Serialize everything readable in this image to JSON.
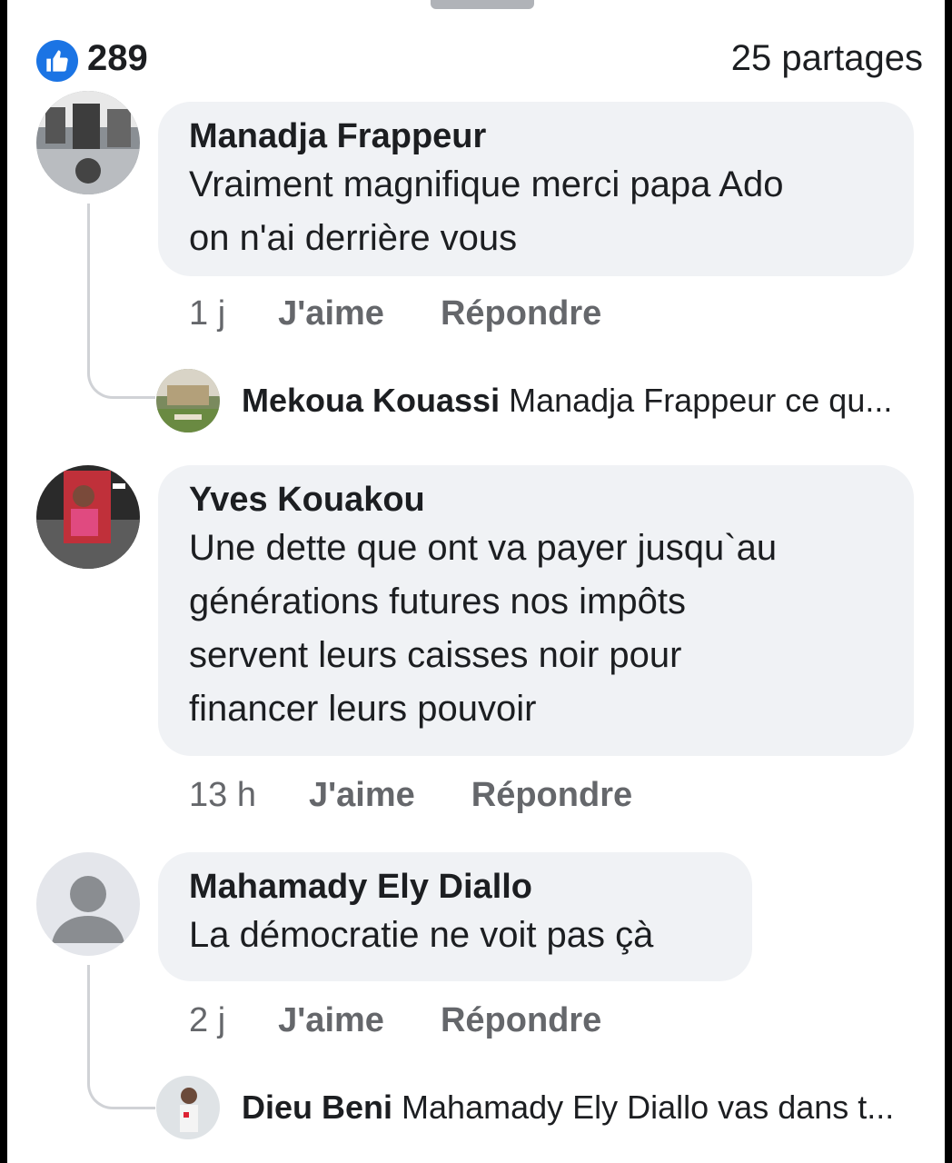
{
  "reactions": {
    "like_count": "289",
    "shares": "25 partages"
  },
  "comments": [
    {
      "author": "Manadja Frappeur",
      "lines": [
        "Vraiment magnifique merci papa Ado",
        "on n'ai derrière vous"
      ],
      "time": "1 j",
      "like_label": "J'aime",
      "reply_label": "Répondre",
      "reply_preview": {
        "author": "Mekoua Kouassi",
        "text": "Manadja Frappeur ce qu..."
      }
    },
    {
      "author": "Yves Kouakou",
      "lines": [
        "Une dette que ont va payer jusqu`au",
        "générations futures nos impôts",
        "servent leurs caisses noir pour",
        "financer leurs pouvoir"
      ],
      "time": "13 h",
      "like_label": "J'aime",
      "reply_label": "Répondre"
    },
    {
      "author": "Mahamady Ely Diallo",
      "lines": [
        "La démocratie ne voit pas çà"
      ],
      "time": "2 j",
      "like_label": "J'aime",
      "reply_label": "Répondre",
      "reply_preview": {
        "author": "Dieu Beni",
        "text": "Mahamady Ely Diallo vas dans t..."
      }
    }
  ],
  "icons": {
    "like": "thumbs-up-icon",
    "default_avatar": "default-user-avatar"
  },
  "colors": {
    "facebook_blue": "#1b74e4",
    "bubble": "#f0f2f5",
    "muted": "#65676b"
  }
}
